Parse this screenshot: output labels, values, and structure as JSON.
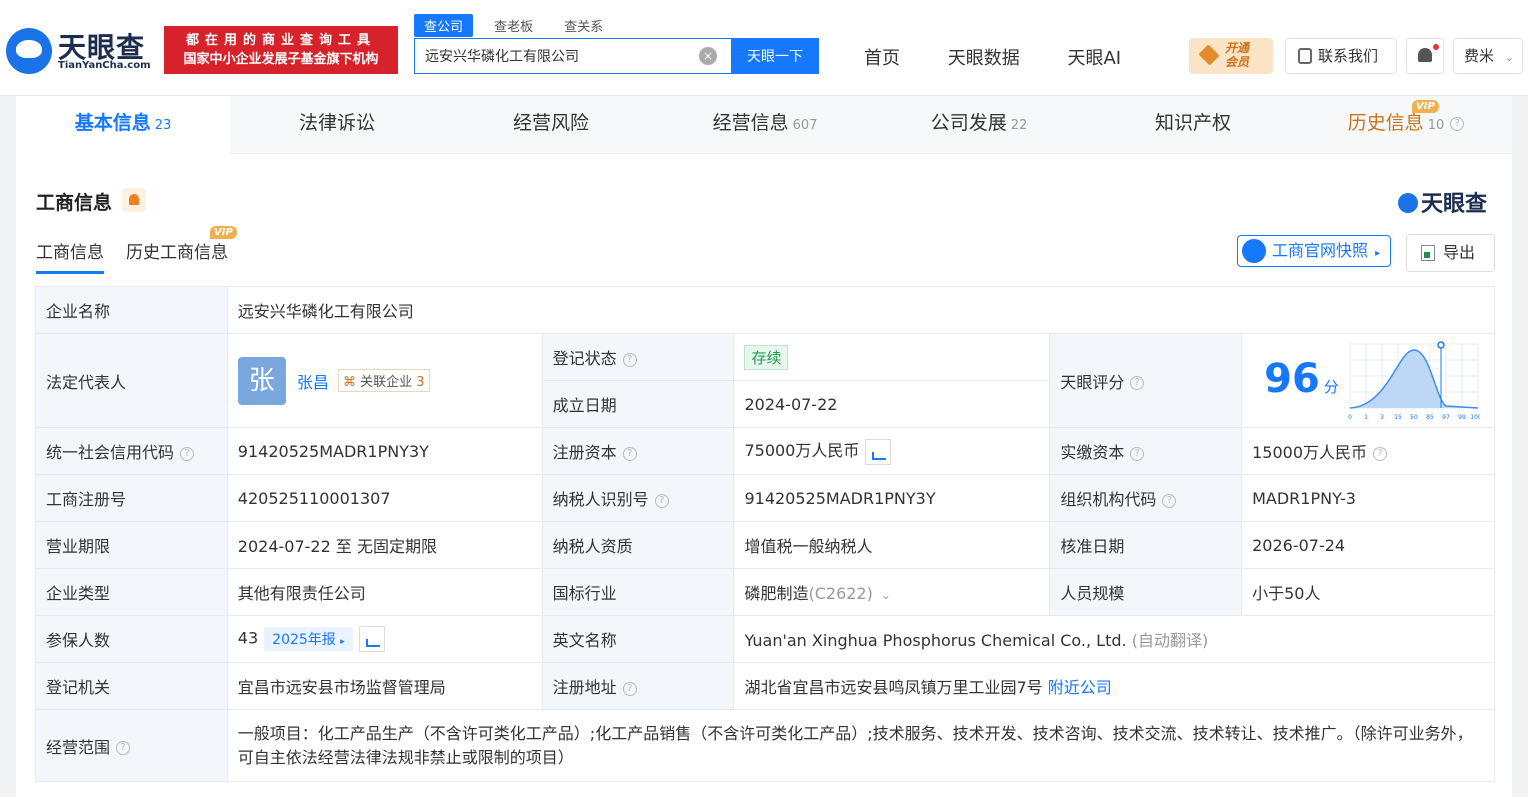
{
  "header": {
    "logo_text": "天眼查",
    "logo_sub": "TianYanCha.com",
    "slogan_line1": "都在用的商业查询工具",
    "slogan_line2": "国家中小企业发展子基金旗下机构",
    "search_tabs": [
      "查公司",
      "查老板",
      "查关系"
    ],
    "search_value": "远安兴华磷化工有限公司",
    "search_button": "天眼一下",
    "nav": [
      "首页",
      "天眼数据",
      "天眼AI"
    ],
    "vip_line1": "开通",
    "vip_line2": "会员",
    "contact": "联系我们",
    "user": "费米"
  },
  "tabs": [
    {
      "label": "基本信息",
      "count": "23"
    },
    {
      "label": "法律诉讼",
      "count": ""
    },
    {
      "label": "经营风险",
      "count": ""
    },
    {
      "label": "经营信息",
      "count": "607"
    },
    {
      "label": "公司发展",
      "count": "22"
    },
    {
      "label": "知识产权",
      "count": ""
    },
    {
      "label": "历史信息",
      "count": "10"
    }
  ],
  "vip_badge": "VIP",
  "section": {
    "title": "工商信息",
    "brand": "天眼查",
    "subtabs": [
      "工商信息",
      "历史工商信息"
    ],
    "snapshot": "工商官网快照",
    "export": "导出"
  },
  "info": {
    "name_label": "企业名称",
    "name": "远安兴华磷化工有限公司",
    "legal_label": "法定代表人",
    "legal_avatar": "张",
    "legal_name": "张昌",
    "rel_label": "关联企业",
    "rel_count": "3",
    "status_label": "登记状态",
    "status": "存续",
    "found_label": "成立日期",
    "found": "2024-07-22",
    "score_label": "天眼评分",
    "score": "96",
    "score_unit": "分",
    "score_ticks": [
      "0",
      "1",
      "3",
      "15",
      "50",
      "85",
      "97",
      "99",
      "100"
    ],
    "credit_label": "统一社会信用代码",
    "credit": "91420525MADR1PNY3Y",
    "capital_label": "注册资本",
    "capital": "75000万人民币",
    "paid_label": "实缴资本",
    "paid": "15000万人民币",
    "reg_label": "工商注册号",
    "reg": "420525110001307",
    "tax_label": "纳税人识别号",
    "tax": "91420525MADR1PNY3Y",
    "org_label": "组织机构代码",
    "org": "MADR1PNY-3",
    "term_label": "营业期限",
    "term": "2024-07-22 至 无固定期限",
    "taxq_label": "纳税人资质",
    "taxq": "增值税一般纳税人",
    "approve_label": "核准日期",
    "approve": "2026-07-24",
    "type_label": "企业类型",
    "type": "其他有限责任公司",
    "industry_label": "国标行业",
    "industry": "磷肥制造",
    "industry_code": "(C2622)",
    "staff_label": "人员规模",
    "staff": "小于50人",
    "insured_label": "参保人数",
    "insured": "43",
    "report": "2025年报",
    "en_label": "英文名称",
    "en": "Yuan'an Xinghua Phosphorus Chemical Co., Ltd.",
    "en_note": "(自动翻译)",
    "auth_label": "登记机关",
    "auth": "宜昌市远安县市场监督管理局",
    "addr_label": "注册地址",
    "addr": "湖北省宜昌市远安县鸣凤镇万里工业园7号",
    "nearby": "附近公司",
    "scope_label": "经营范围",
    "scope": "一般项目：化工产品生产（不含许可类化工产品）;化工产品销售（不含许可类化工产品）;技术服务、技术开发、技术咨询、技术交流、技术转让、技术推广。（除许可业务外，可自主依法经营法律法规非禁止或限制的项目）"
  }
}
